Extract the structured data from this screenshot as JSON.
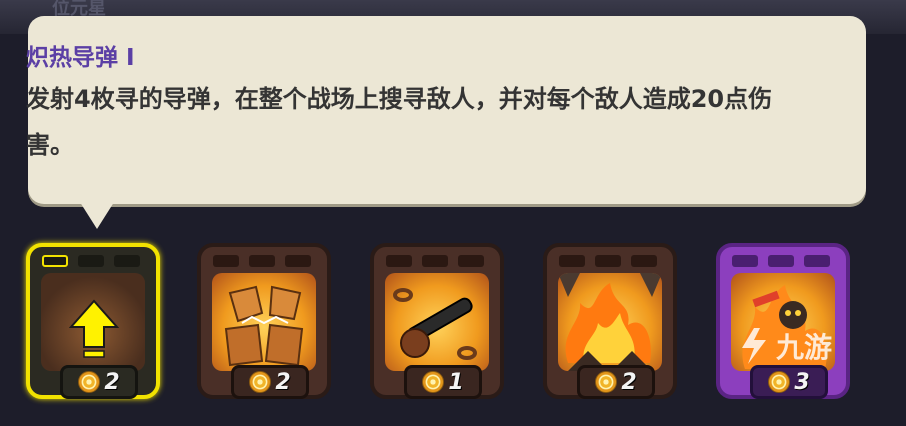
{
  "background": {
    "header_text": "位元星"
  },
  "tooltip": {
    "title": "炽热导弹 I",
    "description": "发射4枚寻的导弹，在整个战场上搜寻敌人，并对每个敌人造成20点伤害。"
  },
  "cards": [
    {
      "name": "炽热导弹 I",
      "cost": "2",
      "style": "selected",
      "icon": "upgrade-arrow-icon"
    },
    {
      "name": "rock-golem-upgrade",
      "cost": "2",
      "style": "normal",
      "icon": "rock-fists-icon"
    },
    {
      "name": "chain-upgrade",
      "cost": "1",
      "style": "normal",
      "icon": "chain-fist-icon"
    },
    {
      "name": "fire-upgrade",
      "cost": "2",
      "style": "normal",
      "icon": "fire-icon"
    },
    {
      "name": "purple-upgrade",
      "cost": "3",
      "style": "purple",
      "icon": "burning-creature-icon"
    }
  ],
  "watermark": {
    "text": "九游"
  },
  "colors": {
    "selected_border": "#f2e200",
    "title": "#5b3fa5",
    "tooltip_bg": "#ece7d5",
    "purple_card": "#8c3fbe"
  }
}
